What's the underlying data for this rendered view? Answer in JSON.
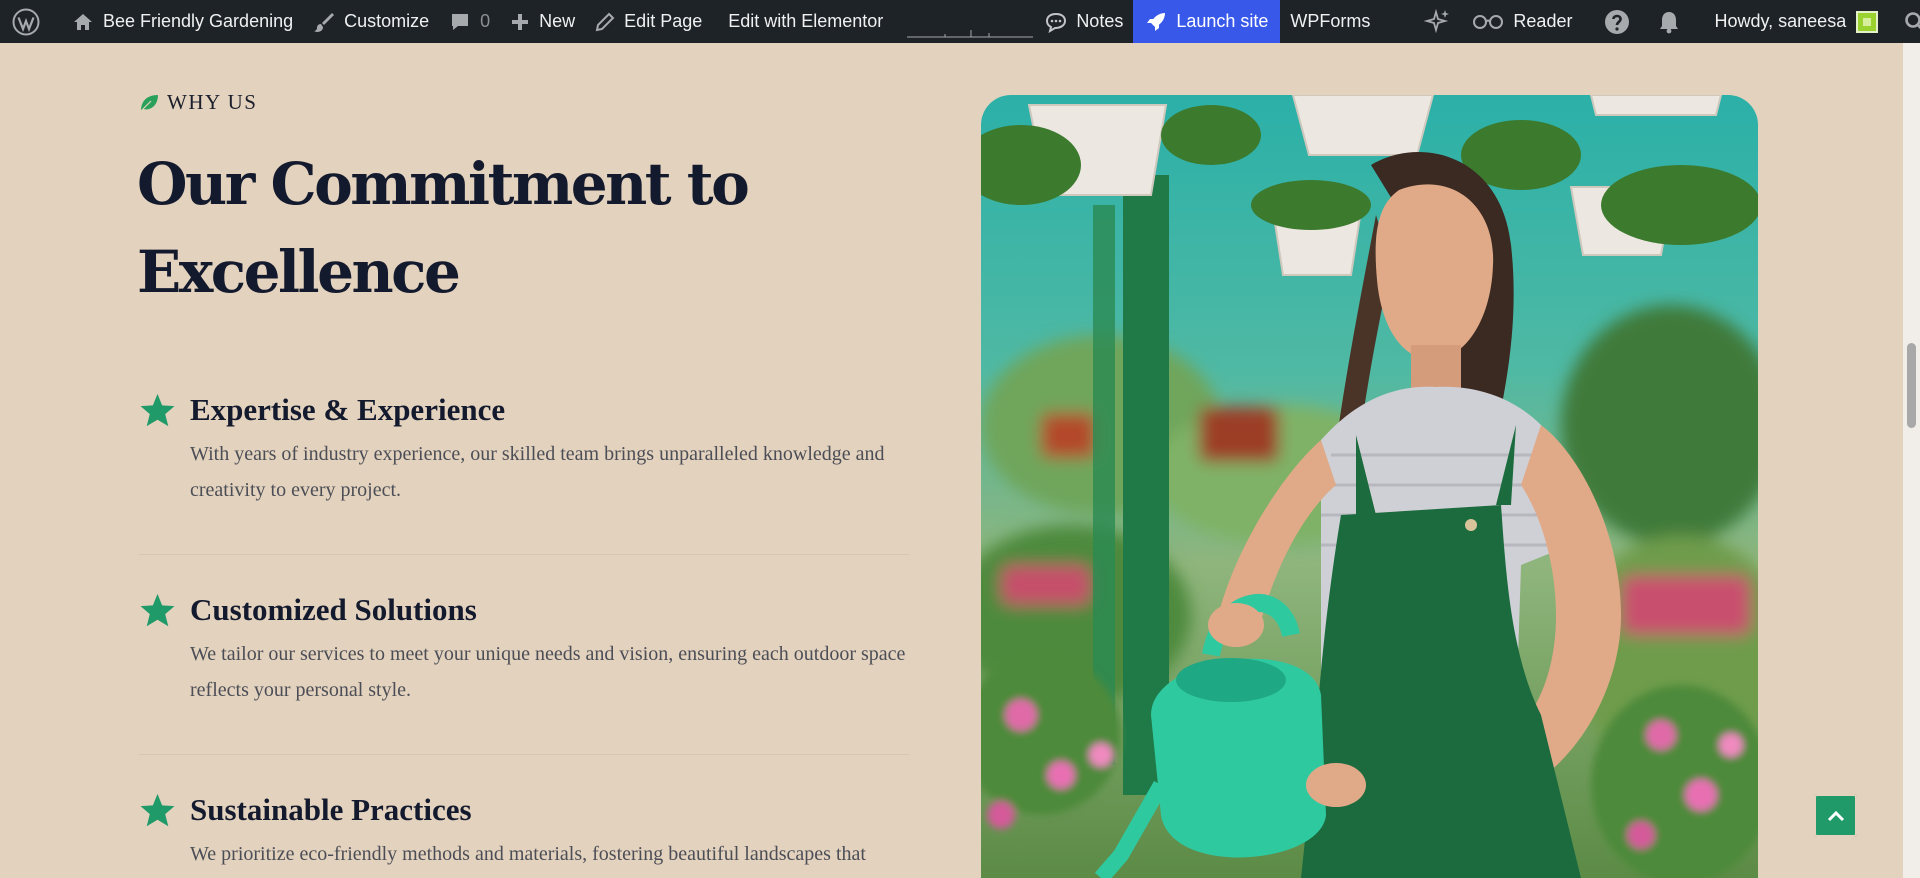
{
  "admin_bar": {
    "site_name": "Bee Friendly Gardening",
    "customize": "Customize",
    "comments_count": "0",
    "new": "New",
    "edit_page": "Edit Page",
    "edit_with_elementor": "Edit with Elementor",
    "notes": "Notes",
    "launch_site": "Launch site",
    "wpforms": "WPForms",
    "reader": "Reader",
    "howdy": "Howdy, saneesa"
  },
  "section": {
    "eyebrow": "WHY US",
    "title": "Our Commitment to Excellence",
    "features": [
      {
        "title": "Expertise & Experience",
        "text": "With years of industry experience, our skilled team brings unparalleled knowledge and creativity to every project."
      },
      {
        "title": "Customized Solutions",
        "text": "We tailor our services to meet your unique needs and vision, ensuring each outdoor space reflects your personal style."
      },
      {
        "title": "Sustainable Practices",
        "text": "We prioritize eco-friendly methods and materials, fostering beautiful landscapes that"
      }
    ]
  },
  "colors": {
    "background": "#e3d2bd",
    "accent_green": "#1f9a68",
    "heading": "#141a2e",
    "body_text": "#4c4e57",
    "admin_bar": "#1d2327",
    "launch_button": "#3858e9"
  },
  "icons": {
    "eyebrow": "leaf-icon",
    "feature": "star-icon",
    "scroll_top": "chevron-up-icon"
  }
}
